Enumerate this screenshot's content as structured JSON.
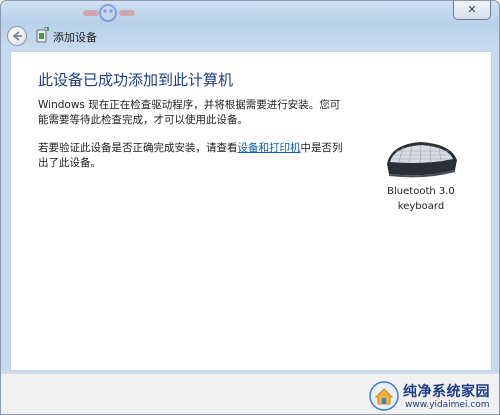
{
  "titlebar": {
    "close_glyph": "✕",
    "back_icon": "back-arrow-icon",
    "wizard_icon": "add-device-wizard-icon",
    "title": "添加设备"
  },
  "main": {
    "heading": "此设备已成功添加到此计算机",
    "paragraph1": "Windows 现在正在检查驱动程序，并将根据需要进行安装。您可能需要等待此检查完成，才可以使用此设备。",
    "paragraph2_before": "若要验证此设备是否正确完成安装，请查看",
    "paragraph2_link": "设备和打印机",
    "paragraph2_after": "中是否列出了此设备。"
  },
  "device": {
    "icon": "keyboard-icon",
    "name_line1": "Bluetooth 3.0",
    "name_line2": "keyboard"
  },
  "watermark": {
    "title": "纯净系统家园",
    "url": "www.yidaimei.com"
  },
  "colors": {
    "heading": "#1f3c88",
    "link": "#0b5fb4",
    "chrome": "#b9d1ea",
    "footer": "#f0f0f0"
  }
}
